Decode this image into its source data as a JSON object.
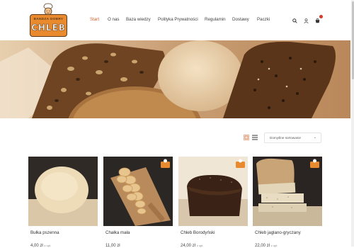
{
  "brand": {
    "tagline": "BANDZA DOBRY",
    "name": "CHLEB"
  },
  "nav": {
    "items": [
      {
        "label": "Start",
        "active": true
      },
      {
        "label": "O nas"
      },
      {
        "label": "Baza wiedzy"
      },
      {
        "label": "Polityka Prywatności"
      },
      {
        "label": "Regulamin"
      },
      {
        "label": "Dostawy"
      },
      {
        "label": "Paczki"
      }
    ]
  },
  "header_icons": {
    "search": "search-icon",
    "account": "user-icon",
    "cart": "cart-icon",
    "cart_count": ""
  },
  "toolbar": {
    "sort_value": "Domyślne sortowanie",
    "view_grid": "grid-view-icon",
    "view_list": "list-view-icon"
  },
  "products": [
    {
      "title": "Bułka pszenna",
      "price": "4,00 zł",
      "price_suffix": "z opt."
    },
    {
      "title": "Chałka mała",
      "price": "11,00 zł",
      "price_suffix": ""
    },
    {
      "title": "Chleb Borodyński",
      "price": "24,00 zł",
      "price_suffix": "z opt."
    },
    {
      "title": "Chleb jaglano-gryczany",
      "price": "22,00 zł",
      "price_suffix": "z opt."
    }
  ],
  "colors": {
    "accent": "#c9612b",
    "logo_orange": "#e98a2f",
    "logo_brown": "#5a3b1e"
  }
}
